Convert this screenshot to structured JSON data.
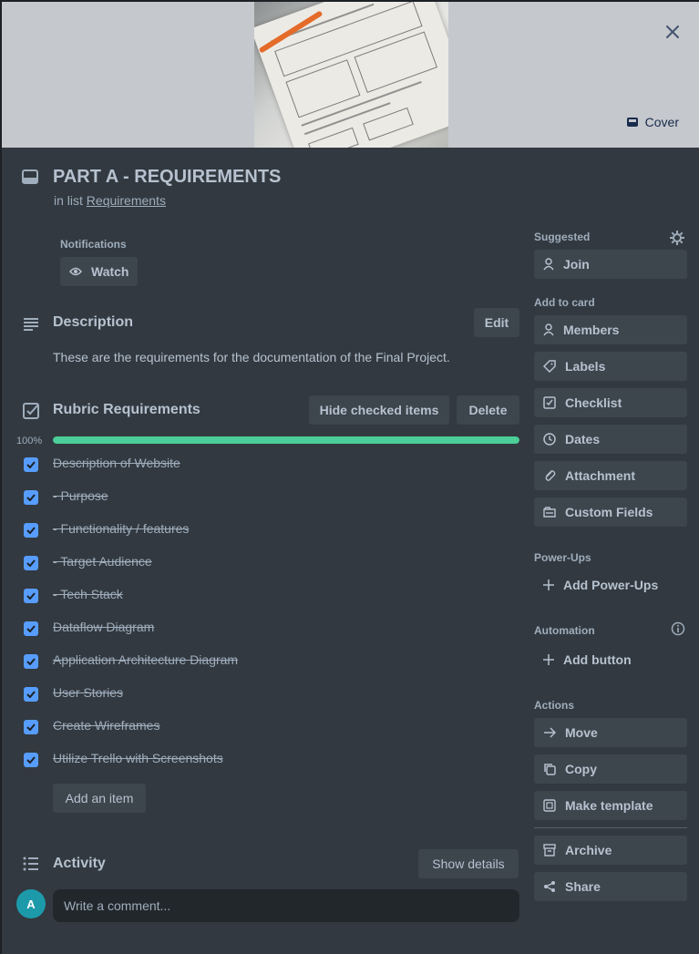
{
  "card": {
    "title": "PART A - REQUIREMENTS",
    "in_list_prefix": "in list",
    "list_name": "Requirements",
    "cover_label": "Cover"
  },
  "notifications": {
    "label": "Notifications",
    "watch_label": "Watch"
  },
  "description": {
    "title": "Description",
    "edit_label": "Edit",
    "text": "These are the requirements for the documentation of the Final Project."
  },
  "checklist": {
    "title": "Rubric Requirements",
    "hide_label": "Hide checked items",
    "delete_label": "Delete",
    "percent": "100%",
    "progress": 1.0,
    "items": [
      {
        "text": "Description of Website",
        "checked": true
      },
      {
        "text": "- Purpose",
        "checked": true
      },
      {
        "text": "- Functionality / features",
        "checked": true
      },
      {
        "text": "- Target Audience",
        "checked": true
      },
      {
        "text": "- Tech Stack",
        "checked": true
      },
      {
        "text": "Dataflow Diagram",
        "checked": true
      },
      {
        "text": "Application Architecture Diagram",
        "checked": true
      },
      {
        "text": "User Stories",
        "checked": true
      },
      {
        "text": "Create Wireframes",
        "checked": true
      },
      {
        "text": "Utilize Trello with Screenshots",
        "checked": true
      }
    ],
    "add_item_label": "Add an item"
  },
  "activity": {
    "title": "Activity",
    "show_details_label": "Show details",
    "avatar_initial": "A",
    "comment_placeholder": "Write a comment..."
  },
  "sidebar": {
    "suggested_label": "Suggested",
    "join_label": "Join",
    "add_to_card_label": "Add to card",
    "add_to_card": [
      {
        "label": "Members",
        "icon": "person-icon"
      },
      {
        "label": "Labels",
        "icon": "tag-icon"
      },
      {
        "label": "Checklist",
        "icon": "checklist-icon"
      },
      {
        "label": "Dates",
        "icon": "clock-icon"
      },
      {
        "label": "Attachment",
        "icon": "paperclip-icon"
      },
      {
        "label": "Custom Fields",
        "icon": "fields-icon"
      }
    ],
    "powerups_label": "Power-Ups",
    "add_powerups_label": "Add Power-Ups",
    "automation_label": "Automation",
    "add_button_label": "Add button",
    "actions_label": "Actions",
    "actions": [
      {
        "label": "Move",
        "icon": "arrow-right-icon"
      },
      {
        "label": "Copy",
        "icon": "copy-icon"
      },
      {
        "label": "Make template",
        "icon": "template-icon"
      }
    ],
    "actions2": [
      {
        "label": "Archive",
        "icon": "archive-icon"
      },
      {
        "label": "Share",
        "icon": "share-icon"
      }
    ]
  },
  "colors": {
    "background": "#323940",
    "button": "#3d454d",
    "progress": "#4bce97",
    "checkbox": "#579dff"
  }
}
